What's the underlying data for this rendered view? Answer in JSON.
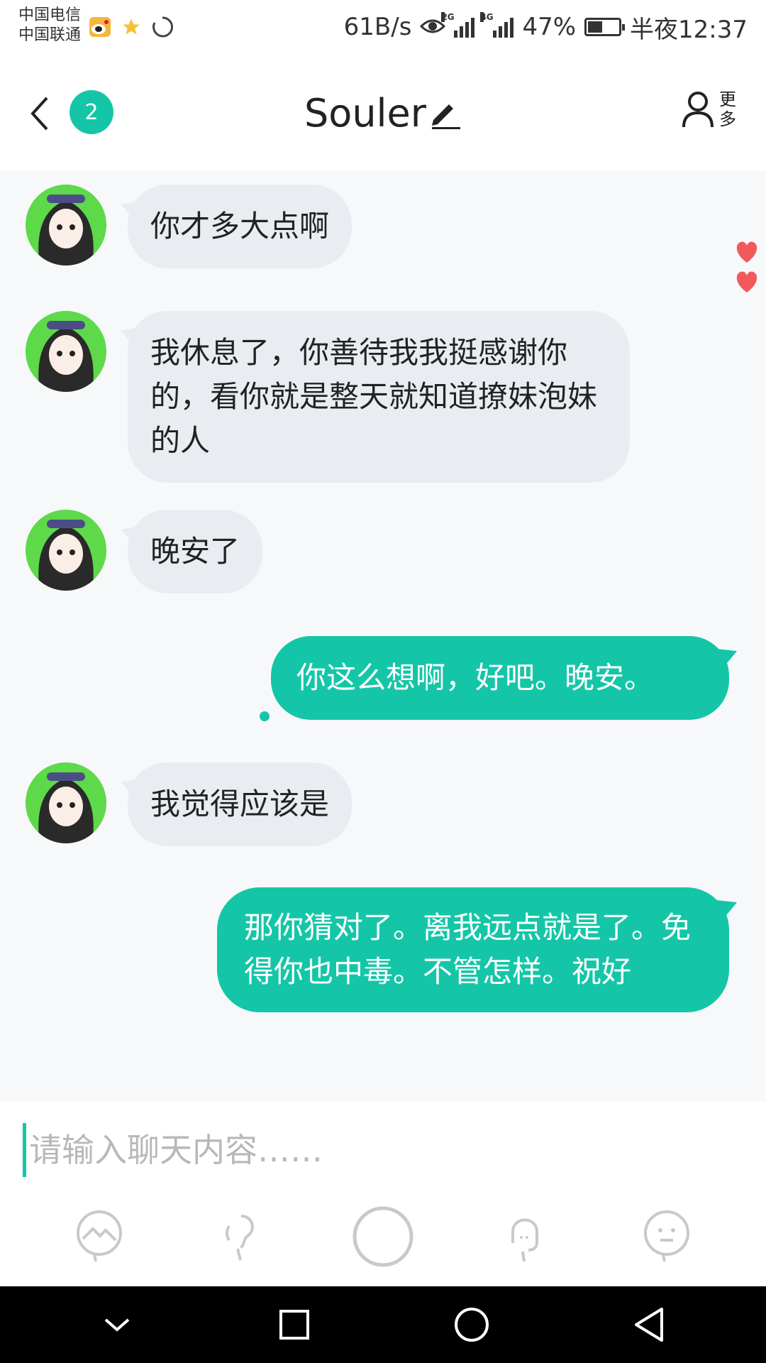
{
  "status_bar": {
    "carrier1": "中国电信",
    "carrier2": "中国联通",
    "speed": "61B/s",
    "sig1_tag": "2G",
    "sig2_tag": "4G",
    "battery": "47%",
    "time": "半夜12:37"
  },
  "header": {
    "back_icon": "chevron-left-icon",
    "unread_count": "2",
    "title": "Souler",
    "more_label": "更多",
    "accent": "#14c6a7"
  },
  "messages": [
    {
      "side": "in",
      "text": "你才多大点啊"
    },
    {
      "side": "in",
      "text": "我休息了，你善待我我挺感谢你的，看你就是整天就知道撩妹泡妹的人"
    },
    {
      "side": "in",
      "text": "晚安了"
    },
    {
      "side": "out",
      "text": "你这么想啊，好吧。晚安。"
    },
    {
      "side": "in",
      "text": "我觉得应该是"
    },
    {
      "side": "out",
      "text": "那你猜对了。离我远点就是了。免得你也中毒。不管怎样。祝好"
    }
  ],
  "input": {
    "placeholder": "请输入聊天内容……",
    "value": ""
  },
  "toolbar": [
    "image-icon",
    "voice-icon",
    "record-icon",
    "mic-icon",
    "emoji-icon"
  ],
  "nav": [
    "collapse-icon",
    "recent-apps-icon",
    "home-icon",
    "back-icon"
  ]
}
